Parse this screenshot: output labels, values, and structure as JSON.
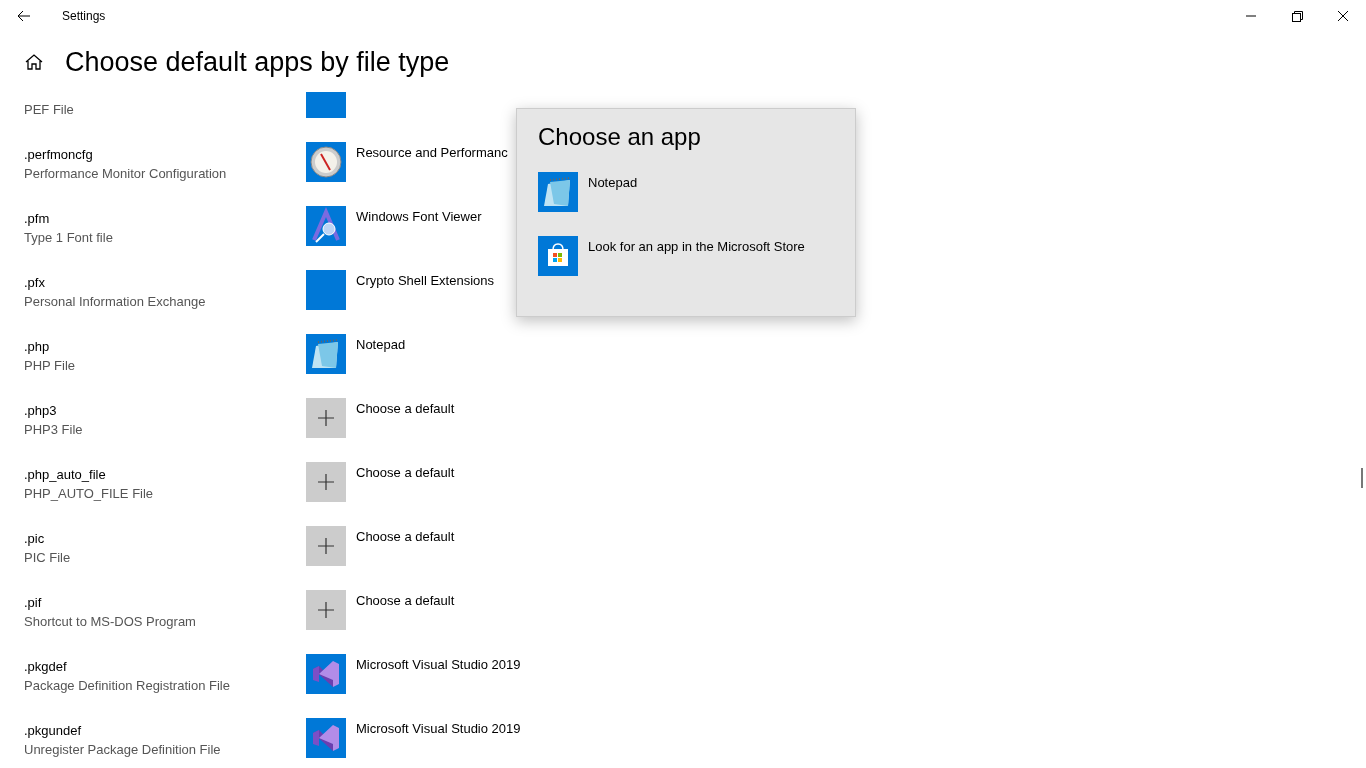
{
  "window": {
    "title": "Settings"
  },
  "page_title": "Choose default apps by file type",
  "rows": [
    {
      "description": "PEF File",
      "kind": "partial"
    },
    {
      "extension": ".perfmoncfg",
      "description": "Performance Monitor Configuration",
      "kind": "gauge",
      "app": "Resource and Performanc"
    },
    {
      "extension": ".pfm",
      "description": "Type 1 Font file",
      "kind": "font",
      "app": "Windows Font Viewer"
    },
    {
      "extension": ".pfx",
      "description": "Personal Information Exchange",
      "kind": "blank",
      "app": "Crypto Shell Extensions"
    },
    {
      "extension": ".php",
      "description": "PHP File",
      "kind": "notepad",
      "app": "Notepad"
    },
    {
      "extension": ".php3",
      "description": "PHP3 File",
      "kind": "plus",
      "app": "Choose a default"
    },
    {
      "extension": ".php_auto_file",
      "description": "PHP_AUTO_FILE File",
      "kind": "plus",
      "app": "Choose a default"
    },
    {
      "extension": ".pic",
      "description": "PIC File",
      "kind": "plus",
      "app": "Choose a default"
    },
    {
      "extension": ".pif",
      "description": "Shortcut to MS-DOS Program",
      "kind": "plus",
      "app": "Choose a default"
    },
    {
      "extension": ".pkgdef",
      "description": "Package Definition Registration File",
      "kind": "vs",
      "app": "Microsoft Visual Studio 2019"
    },
    {
      "extension": ".pkgundef",
      "description": "Unregister Package Definition File",
      "kind": "vs",
      "app": "Microsoft Visual Studio 2019"
    }
  ],
  "popup": {
    "title": "Choose an app",
    "items": [
      {
        "kind": "notepad",
        "label": "Notepad"
      },
      {
        "kind": "store",
        "label": "Look for an app in the Microsoft Store"
      }
    ]
  }
}
